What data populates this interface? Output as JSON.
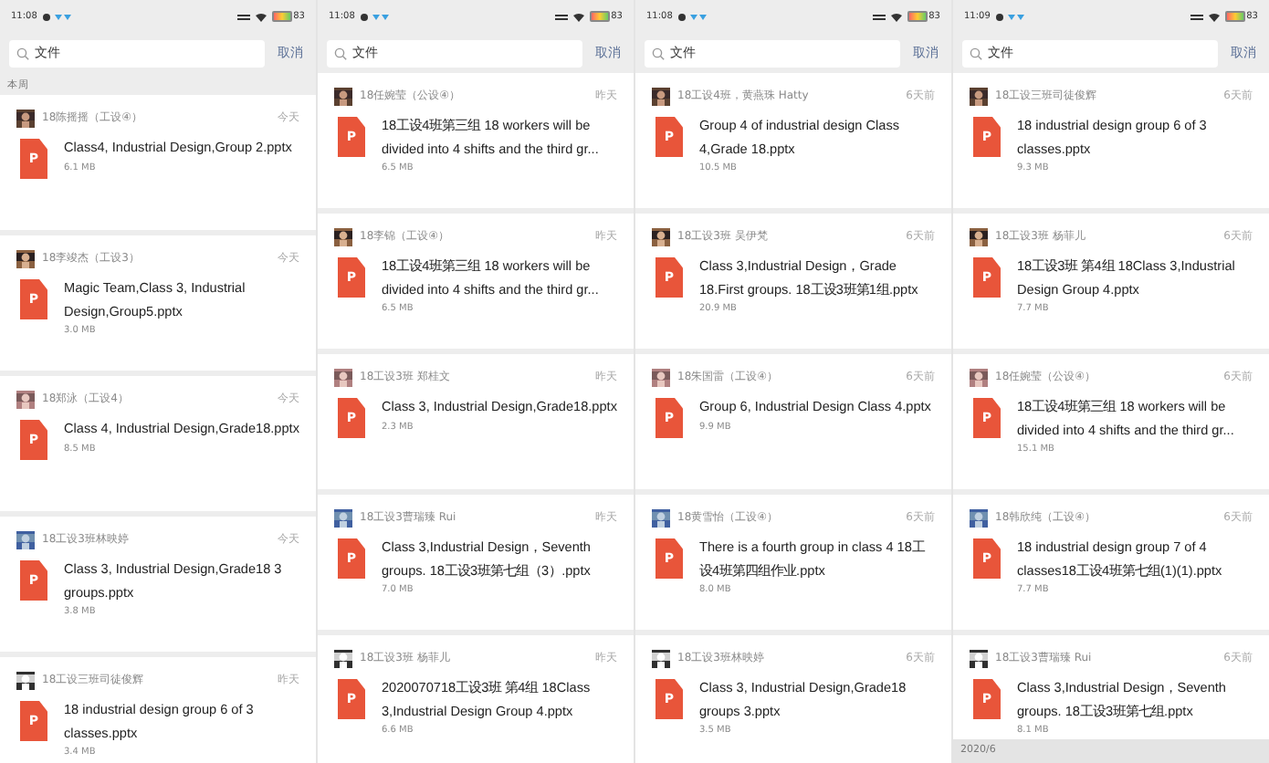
{
  "panels": [
    {
      "status_bar": {
        "time": "11:08",
        "battery": "83"
      },
      "search": {
        "value": "文件"
      },
      "cancel": "取消",
      "section_top": "本周",
      "items": [
        {
          "sender": "18陈摇摇（工设④）",
          "date": "今天",
          "icon_letter": "P",
          "file": "Class4, Industrial Design,Group 2.pptx",
          "size": "6.1 MB"
        },
        {
          "sender": "18李竣杰（工设3）",
          "date": "今天",
          "icon_letter": "P",
          "file": "Magic Team,Class 3, Industrial Design,Group5.pptx",
          "size": "3.0 MB"
        },
        {
          "sender": "18郑泳（工设4）",
          "date": "今天",
          "icon_letter": "P",
          "file": "Class 4, Industrial Design,Grade18.pptx",
          "size": "8.5 MB"
        },
        {
          "sender": "18工设3班林映婷",
          "date": "今天",
          "icon_letter": "P",
          "file": "Class 3, Industrial Design,Grade18 3 groups.pptx",
          "size": "3.8 MB"
        },
        {
          "sender": "18工设三班司徒俊辉",
          "date": "昨天",
          "icon_letter": "P",
          "file": "18 industrial design group  6 of 3 classes.pptx",
          "size": "3.4 MB"
        }
      ]
    },
    {
      "status_bar": {
        "time": "11:08",
        "battery": "83"
      },
      "search": {
        "value": "文件"
      },
      "cancel": "取消",
      "items": [
        {
          "sender": "18任婉莹（公设④）",
          "date": "昨天",
          "icon_letter": "P",
          "file": "18工设4班第三组 18 workers will be divided into 4 shifts and the third gr...",
          "size": "6.5 MB"
        },
        {
          "sender": "18李锦（工设④）",
          "date": "昨天",
          "icon_letter": "P",
          "file": "18工设4班第三组 18 workers will be divided into 4 shifts and the third gr...",
          "size": "6.5 MB"
        },
        {
          "sender": "18工设3班 郑桂文",
          "date": "昨天",
          "icon_letter": "P",
          "file": "Class 3, Industrial Design,Grade18.pptx",
          "size": "2.3 MB"
        },
        {
          "sender": "18工设3曹瑞臻 Rui",
          "date": "昨天",
          "icon_letter": "P",
          "file": "Class 3,Industrial  Design，Seventh groups. 18工设3班第七组（3）.pptx",
          "size": "7.0 MB"
        },
        {
          "sender": "18工设3班 杨菲儿",
          "date": "昨天",
          "icon_letter": "P",
          "file": "2020070718工设3班 第4组 18Class 3,Industrial Design Group 4.pptx",
          "size": "6.6 MB"
        }
      ]
    },
    {
      "status_bar": {
        "time": "11:08",
        "battery": "83"
      },
      "search": {
        "value": "文件"
      },
      "cancel": "取消",
      "items": [
        {
          "sender": "18工设4班，黄燕珠 Hatty",
          "date": "6天前",
          "icon_letter": "P",
          "file": "Group 4 of industrial design Class 4,Grade 18.pptx",
          "size": "10.5 MB"
        },
        {
          "sender": "18工设3班 吴伊梵",
          "date": "6天前",
          "icon_letter": "P",
          "file": "Class 3,Industrial  Design，Grade 18.First groups. 18工设3班第1组.pptx",
          "size": "20.9 MB"
        },
        {
          "sender": "18朱国雷（工设④）",
          "date": "6天前",
          "icon_letter": "P",
          "file": "Group 6, Industrial Design Class 4.pptx",
          "size": "9.9 MB"
        },
        {
          "sender": "18黄雪怡（工设④）",
          "date": "6天前",
          "icon_letter": "P",
          "file": "There is a fourth group in class 4  18工设4班第四组作业.pptx",
          "size": "8.0 MB"
        },
        {
          "sender": "18工设3班林映婷",
          "date": "6天前",
          "icon_letter": "P",
          "file": "Class 3, Industrial Design,Grade18 groups 3.pptx",
          "size": "3.5 MB"
        }
      ]
    },
    {
      "status_bar": {
        "time": "11:09",
        "battery": "83"
      },
      "search": {
        "value": "文件"
      },
      "cancel": "取消",
      "section_bottom": "2020/6",
      "items": [
        {
          "sender": "18工设三班司徒俊辉",
          "date": "6天前",
          "icon_letter": "P",
          "file": "18 industrial design group 6 of 3 classes.pptx",
          "size": "9.3 MB"
        },
        {
          "sender": "18工设3班 杨菲儿",
          "date": "6天前",
          "icon_letter": "P",
          "file": "18工设3班 第4组 18Class 3,Industrial Design Group 4.pptx",
          "size": "7.7 MB"
        },
        {
          "sender": "18任婉莹（公设④）",
          "date": "6天前",
          "icon_letter": "P",
          "file": "18工设4班第三组 18 workers will be divided into 4 shifts and the third gr...",
          "size": "15.1 MB"
        },
        {
          "sender": "18韩欣纯（工设④）",
          "date": "6天前",
          "icon_letter": "P",
          "file": "18 industrial design group 7 of 4 classes18工设4班第七组(1)(1).pptx",
          "size": "7.7 MB"
        },
        {
          "sender": "18工设3曹瑞臻 Rui",
          "date": "6天前",
          "icon_letter": "P",
          "file": "Class 3,Industrial  Design，Seventh groups. 18工设3班第七组.pptx",
          "size": "8.1 MB"
        }
      ]
    }
  ]
}
